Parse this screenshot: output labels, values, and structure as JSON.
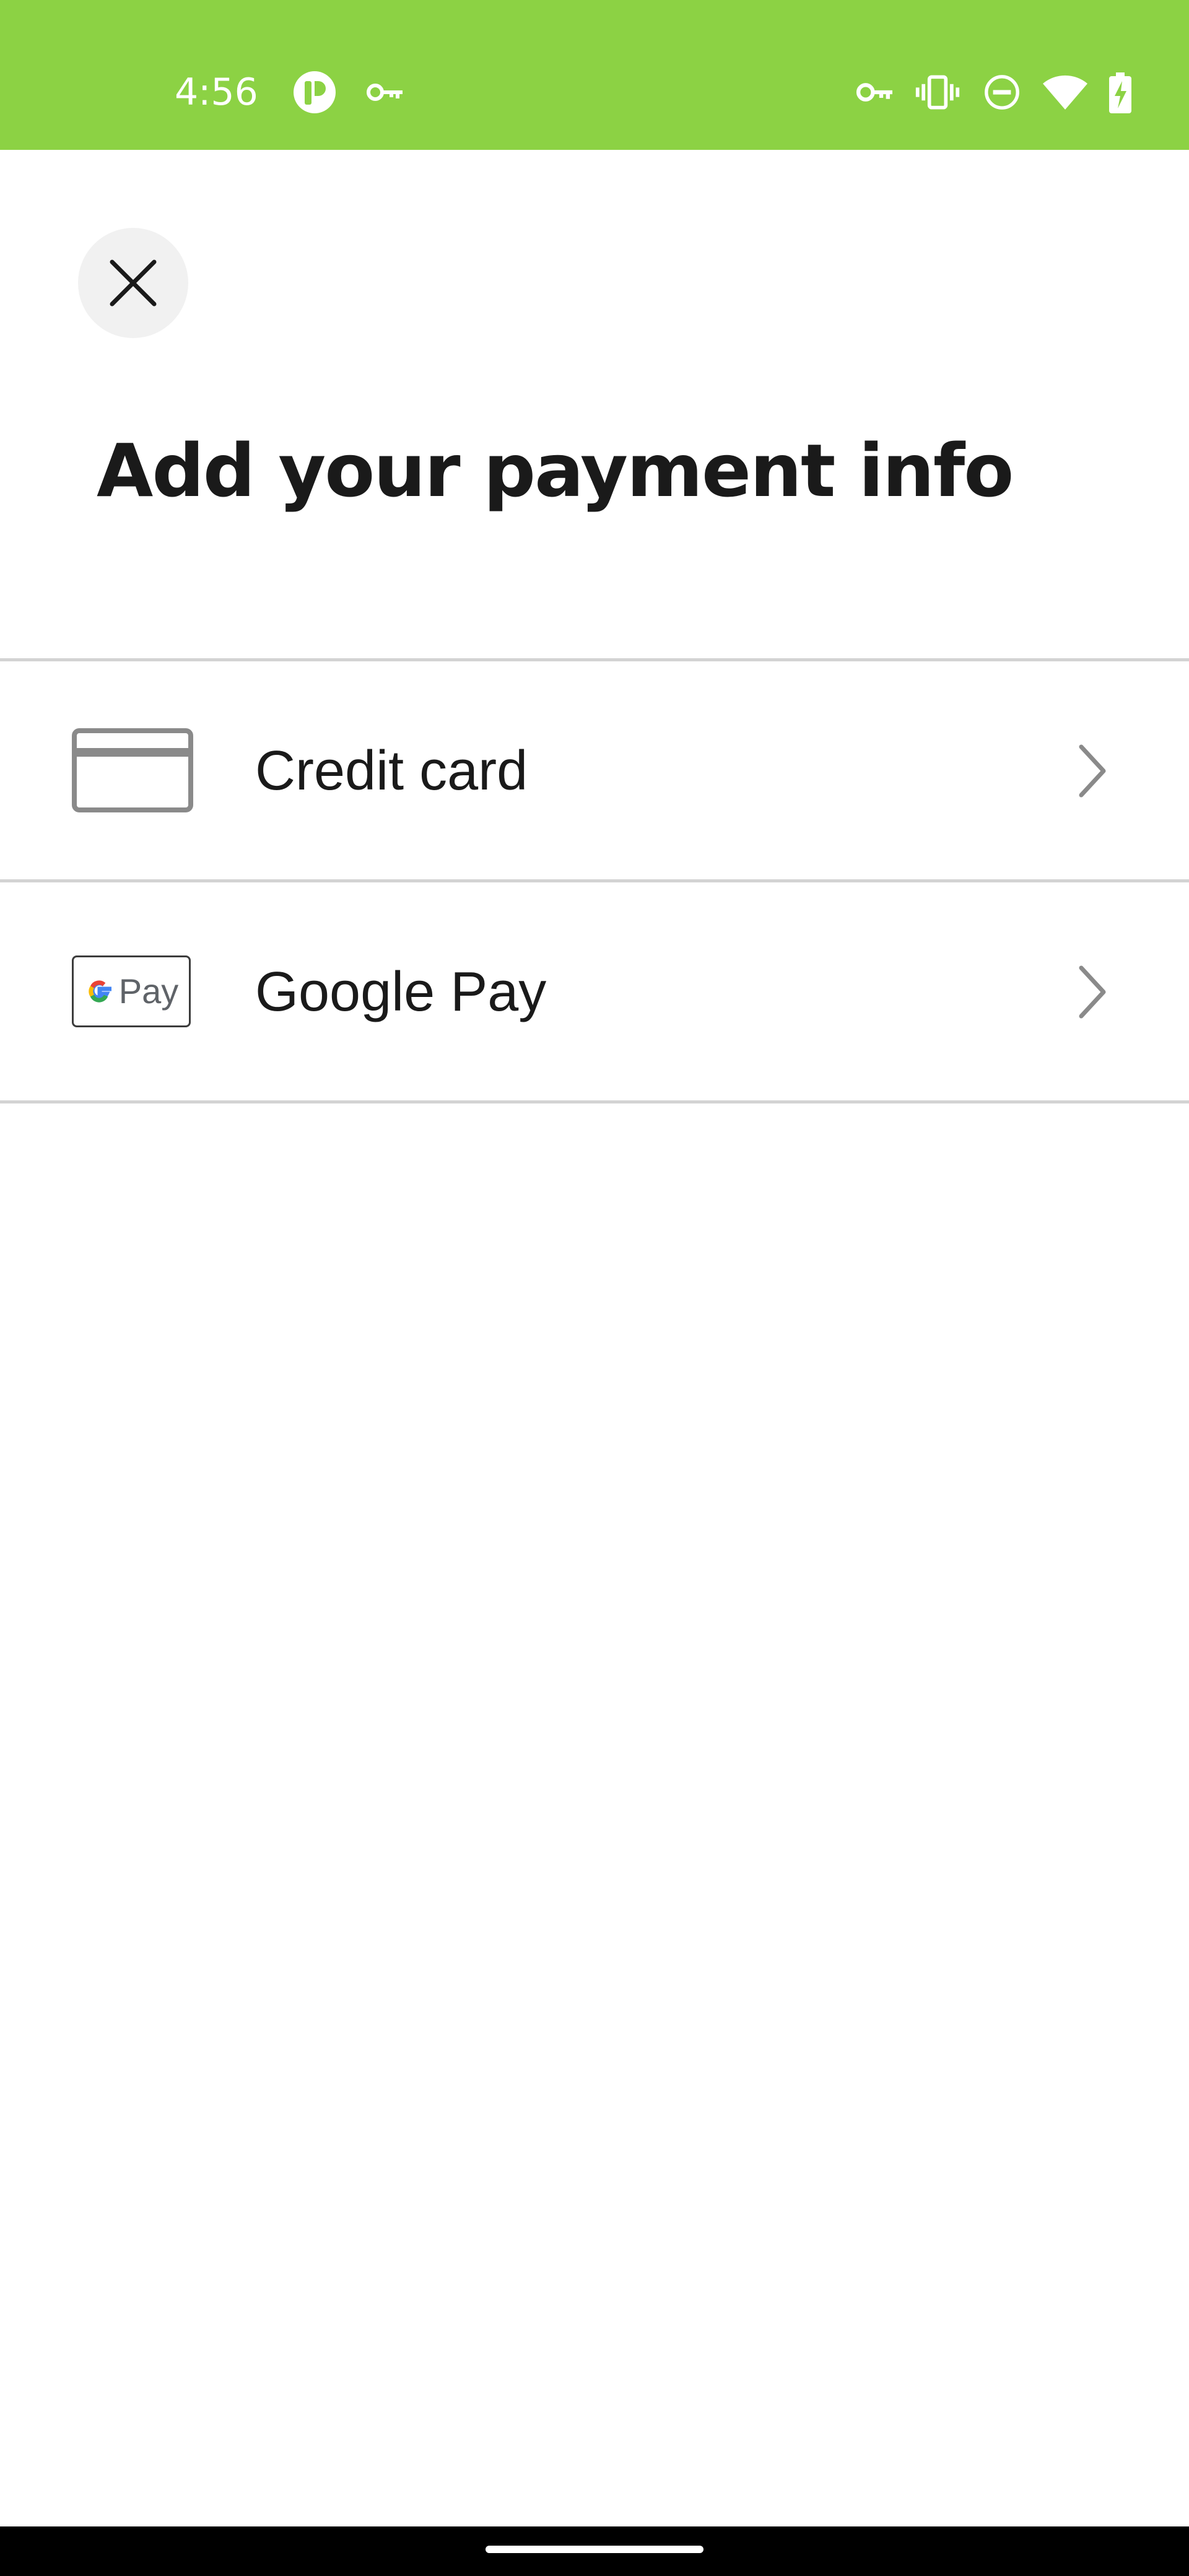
{
  "status_bar": {
    "time": "4:56",
    "background_color": "#8cd244",
    "left_icons": [
      "app-notification-icon",
      "vpn-key-icon"
    ],
    "right_icons": [
      "vpn-key-icon",
      "vibrate-icon",
      "do-not-disturb-icon",
      "wifi-icon",
      "battery-charging-icon"
    ]
  },
  "header": {
    "close_icon": "close-icon",
    "title": "Add your payment info"
  },
  "payment_options": [
    {
      "label": "Credit card",
      "icon": "credit-card-icon"
    },
    {
      "label": "Google Pay",
      "icon": "google-pay-logo",
      "logo_text": "Pay"
    }
  ],
  "colors": {
    "accent": "#8cd244",
    "divider": "#d3d3d3",
    "icon_gray": "#8a8a8a",
    "text": "#1a1a1a"
  }
}
